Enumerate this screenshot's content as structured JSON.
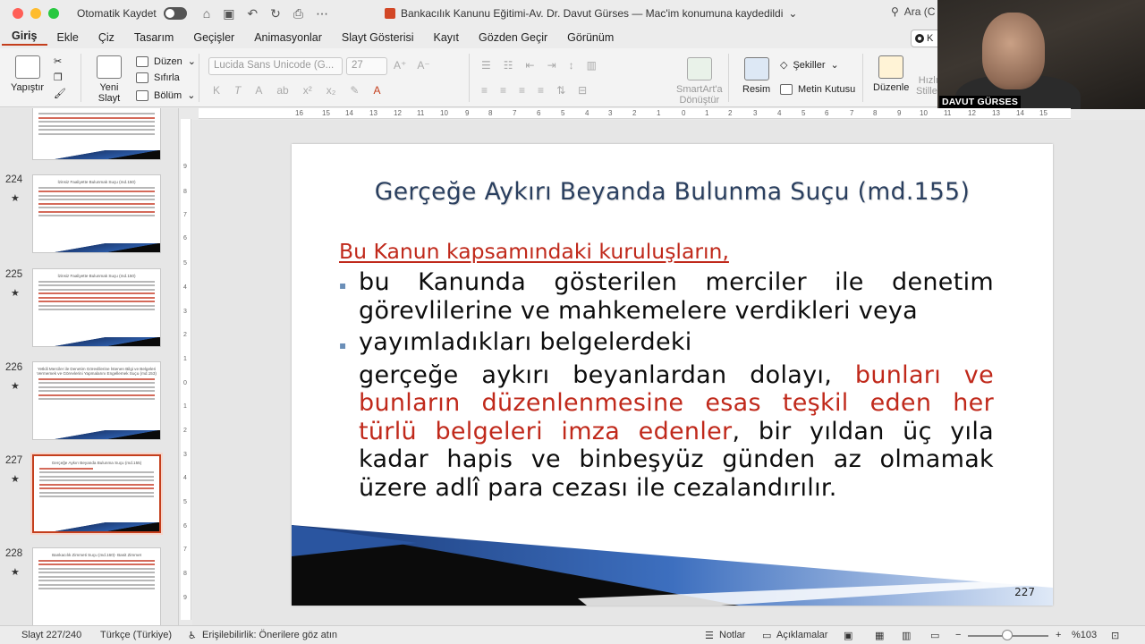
{
  "titlebar": {
    "autosave_label": "Otomatik Kaydet",
    "doc_title": "Bankacılık Kanunu Eğitimi-Av. Dr. Davut Gürses — Mac'im konumuna kaydedildi",
    "search_placeholder": "Ara (C"
  },
  "menu": [
    "Giriş",
    "Ekle",
    "Çiz",
    "Tasarım",
    "Geçişler",
    "Animasyonlar",
    "Slayt Gösterisi",
    "Kayıt",
    "Gözden Geçir",
    "Görünüm"
  ],
  "ribbon": {
    "paste": "Yapıştır",
    "new_slide_1": "Yeni",
    "new_slide_2": "Slayt",
    "layout": "Düzen",
    "reset": "Sıfırla",
    "section": "Bölüm",
    "font_name": "Lucida Sans Unicode (G...",
    "font_size": "27",
    "smartart_1": "SmartArt'a",
    "smartart_2": "Dönüştür",
    "picture": "Resim",
    "shapes": "Şekiller",
    "textbox": "Metin Kutusu",
    "arrange": "Düzenle",
    "quick_styles_1": "Hızlı",
    "quick_styles_2": "Stiller"
  },
  "webcam": {
    "name": "DAVUT GÜRSES"
  },
  "share_label": "K",
  "thumbnails": [
    {
      "number": "224",
      "title": "İzinsiz Faaliyette Bulunmak Suçu (md.150)"
    },
    {
      "number": "225",
      "title": "İzinsiz Faaliyette Bulunmak Suçu (md.150)"
    },
    {
      "number": "226",
      "title": "Yetkili Merciler ile Denetim Görevlilerine İstenen Bilgi ve Belgeleri Vermemek ve Görevlerini Yapmalarını Engellemek Suçu (md.153)"
    },
    {
      "number": "227",
      "title": "Gerçeğe Aykırı Beyanda Bulunma Suçu (md.155)"
    },
    {
      "number": "228",
      "title": "Bankacılık Zimmeti Suçu (md.160)- Basit Zimmet"
    }
  ],
  "slide": {
    "title": "Gerçeğe Aykırı Beyanda Bulunma Suçu (md.155)",
    "heading": "Bu Kanun kapsamındaki kuruluşların,",
    "line1": "bu Kanunda gösterilen merciler ile denetim",
    "line2": "görevlilerine ve mahkemelere verdikleri veya",
    "line3": "yayımladıkları belgelerdeki",
    "line4a": "gerçeğe aykırı beyanlardan dolayı, ",
    "line4b": "bunları ve",
    "line5": "bunların düzenlenmesine esas teşkil eden her",
    "line6a": "türlü belgeleri imza edenler",
    "line6b": ", bir yıldan üç yıla",
    "line7": "kadar hapis ve binbeşyüz günden az olmamak",
    "line8": "üzere adlî para cezası ile cezalandırılır.",
    "number": "227"
  },
  "statusbar": {
    "slide_info": "Slayt 227/240",
    "language": "Türkçe (Türkiye)",
    "accessibility": "Erişilebilirlik: Önerilere göz atın",
    "notes": "Notlar",
    "comments": "Açıklamalar",
    "zoom": "%103"
  },
  "colors": {
    "accent": "#c43e1c",
    "slide_red": "#c0291b",
    "title_blue": "#2a3f5f"
  }
}
